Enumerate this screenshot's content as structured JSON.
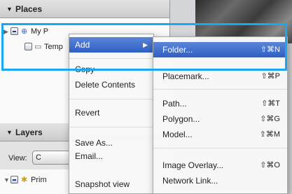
{
  "places_panel": {
    "header": "Places",
    "items": [
      {
        "label": "My P"
      },
      {
        "label": "Temp"
      }
    ]
  },
  "layers_panel": {
    "header": "Layers",
    "view_label": "View:",
    "view_value": "C",
    "items": [
      {
        "label": "Prim"
      }
    ]
  },
  "context_menu": {
    "items": [
      {
        "label": "Add"
      },
      {
        "label": "Copy"
      },
      {
        "label": "Delete Contents"
      },
      {
        "label": "Revert"
      },
      {
        "label": "Save As..."
      },
      {
        "label": "Email..."
      },
      {
        "label": "Snapshot view"
      }
    ]
  },
  "add_submenu": {
    "items": [
      {
        "label": "Folder...",
        "shortcut": "⇧⌘N"
      },
      {
        "label": "Placemark...",
        "shortcut": "⇧⌘P"
      },
      {
        "label": "Path...",
        "shortcut": "⇧⌘T"
      },
      {
        "label": "Polygon...",
        "shortcut": "⇧⌘G"
      },
      {
        "label": "Model...",
        "shortcut": "⇧⌘M"
      },
      {
        "label": "Image Overlay...",
        "shortcut": "⇧⌘O"
      },
      {
        "label": "Network Link..."
      }
    ]
  },
  "colors": {
    "highlight": "#19a7ee",
    "selection": "#3a6fd2"
  },
  "icons": [
    "disclosure-triangle-icon",
    "checkbox-icon",
    "globe-icon",
    "folder-icon",
    "submenu-arrow-icon"
  ]
}
